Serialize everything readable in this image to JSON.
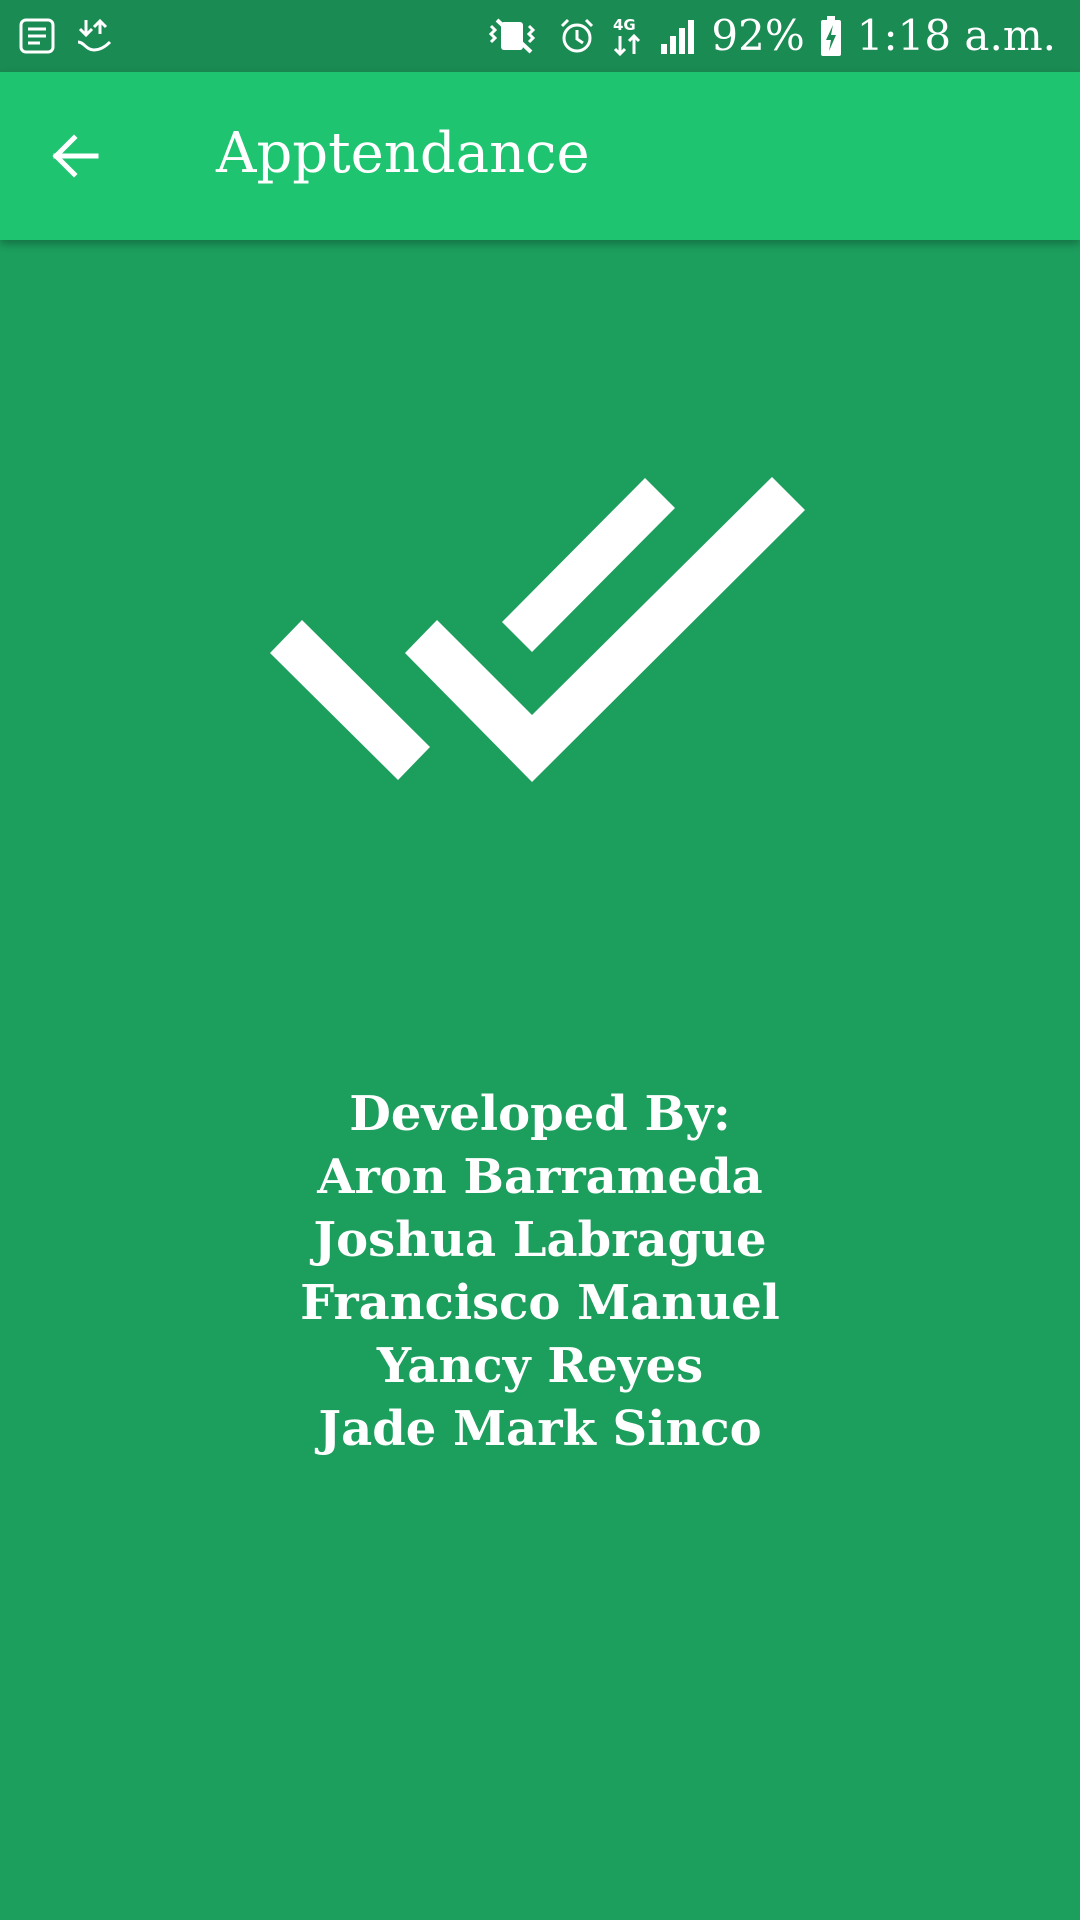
{
  "status_bar": {
    "left_icons": [
      "notes-notification-icon",
      "download-transfer-icon"
    ],
    "right_icons": [
      "vibrate-mute-icon",
      "alarm-icon",
      "4g-data-icon",
      "signal-strength-icon"
    ],
    "battery_percent": "92%",
    "battery_icon": "battery-charging-icon",
    "time": "1:18 a.m."
  },
  "app_bar": {
    "back_icon": "arrow-back-icon",
    "title": "Apptendance"
  },
  "logo": {
    "icon": "double-check-logo-icon"
  },
  "credits": {
    "heading": "Developed By:",
    "developers": [
      "Aron Barrameda",
      "Joshua Labrague",
      "Francisco Manuel",
      "Yancy Reyes",
      "Jade Mark Sinco"
    ]
  },
  "colors": {
    "status_bar": "#1a8b52",
    "app_bar": "#1fc471",
    "background": "#1c9e5d",
    "foreground": "#ffffff"
  }
}
